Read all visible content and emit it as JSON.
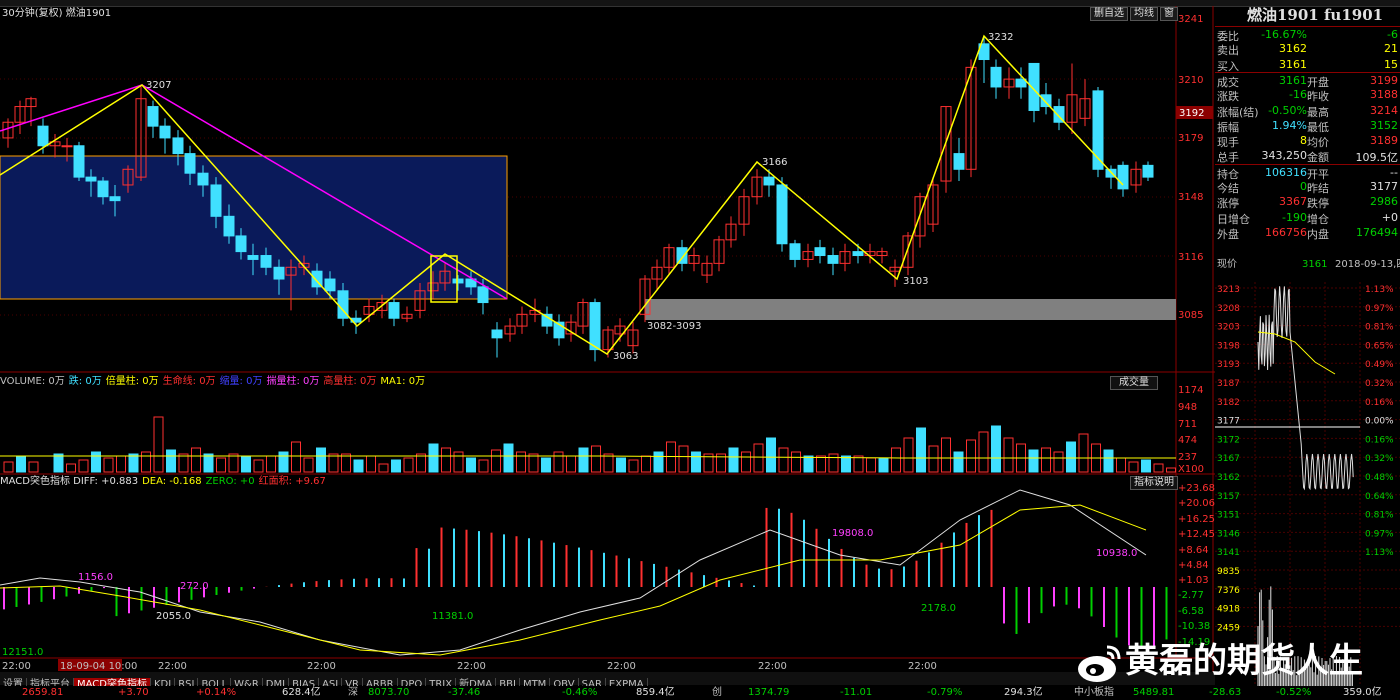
{
  "window": {
    "title": "30分钟(复权)  燃油1901"
  },
  "toolbar": {
    "buttons": [
      "删自选",
      "均线",
      "窗"
    ]
  },
  "price_axis": {
    "labels": [
      "3241",
      "3210",
      "3192",
      "3179",
      "3148",
      "3116",
      "3085"
    ],
    "current": "3192"
  },
  "annotations": {
    "p3207": "3207",
    "p3232": "3232",
    "p3166": "3166",
    "p3103": "3103",
    "p3063": "3063",
    "zone": "3082-3093"
  },
  "volume_bar": {
    "items": [
      {
        "text": "VOLUME: 0万",
        "color": "#c0c0c0"
      },
      {
        "text": "跌: 0万",
        "color": "#40e0ff"
      },
      {
        "text": "倍量柱: 0万",
        "color": "#ffff00"
      },
      {
        "text": "生命线: 0万",
        "color": "#ff3030"
      },
      {
        "text": "缩量: 0万",
        "color": "#4040ff"
      },
      {
        "text": "揣量柱: 0万",
        "color": "#ff40ff"
      },
      {
        "text": "高量柱: 0万",
        "color": "#ff3030"
      },
      {
        "text": "MA1: 0万",
        "color": "#ffff00"
      }
    ],
    "button": "成交量",
    "axis": [
      "1174",
      "948",
      "711",
      "474",
      "237",
      "X100"
    ]
  },
  "macd_bar": {
    "items": [
      {
        "text": "MACD突色指标 DIFF: +0.883",
        "color": "#e0e0e0"
      },
      {
        "text": "DEA: -0.168",
        "color": "#ffff00"
      },
      {
        "text": "ZERO: +0",
        "color": "#00d000"
      },
      {
        "text": "红面积: +9.67",
        "color": "#ff3030"
      }
    ],
    "button": "指标说明",
    "axis": [
      "+23.68",
      "+20.06",
      "+16.25",
      "+12.45",
      "+8.64",
      "+4.84",
      "+1.03",
      "-2.77",
      "-6.58",
      "-10.38",
      "-14.19"
    ],
    "labels": {
      "a": "1156.0",
      "b": "2055.0",
      "c": "11381.0",
      "d": "19808.0",
      "e": "10938.0",
      "f": "2178.0",
      "g": "12151.0",
      "h": "272.0"
    }
  },
  "time_axis": [
    "22:00",
    "18-09-04 10:00",
    "22:00",
    "22:00",
    "22:00",
    "22:00",
    "22:00",
    "22:00"
  ],
  "bottom_tabs": [
    "设置",
    "指标平台",
    "MACD突色指标",
    "KDJ",
    "RSI",
    "BOLL",
    "W&R",
    "DMI",
    "BIAS",
    "ASI",
    "VR",
    "ARBR",
    "DPO",
    "TRIX",
    "新DMA",
    "BBI",
    "MTM",
    "OBV",
    "SAR",
    "EXPMA"
  ],
  "status": [
    {
      "t": "2659.81",
      "c": "#ff3030"
    },
    {
      "t": "+3.70",
      "c": "#ff3030"
    },
    {
      "t": "+0.14%",
      "c": "#ff3030"
    },
    {
      "t": "628.4亿",
      "c": "#e0e0e0"
    },
    {
      "t": "深",
      "c": "#c0c0c0"
    },
    {
      "t": "8073.70",
      "c": "#00d000"
    },
    {
      "t": "-37.46",
      "c": "#00d000"
    },
    {
      "t": "-0.46%",
      "c": "#00d000"
    },
    {
      "t": "859.4亿",
      "c": "#e0e0e0"
    },
    {
      "t": "创",
      "c": "#c0c0c0"
    },
    {
      "t": "1374.79",
      "c": "#00d000"
    },
    {
      "t": "-11.01",
      "c": "#00d000"
    },
    {
      "t": "-0.79%",
      "c": "#00d000"
    },
    {
      "t": "294.3亿",
      "c": "#e0e0e0"
    },
    {
      "t": "中小板指",
      "c": "#c0c0c0"
    },
    {
      "t": "5489.81",
      "c": "#00d000"
    },
    {
      "t": "-28.63",
      "c": "#00d000"
    },
    {
      "t": "-0.52%",
      "c": "#00d000"
    },
    {
      "t": "359.0亿",
      "c": "#e0e0e0"
    }
  ],
  "quote": {
    "title": "燃油1901 fu1901",
    "rows": [
      {
        "l1": "委比",
        "v1": "-16.67%",
        "c1": "#00d000",
        "l2": "",
        "v2": "-6",
        "c2": "#00d000"
      },
      {
        "l1": "卖出",
        "v1": "3162",
        "c1": "#ffff00",
        "l2": "",
        "v2": "21",
        "c2": "#ffff00"
      },
      {
        "l1": "买入",
        "v1": "3161",
        "c1": "#ffff00",
        "l2": "",
        "v2": "15",
        "c2": "#ffff00"
      },
      {
        "l1": "成交",
        "v1": "3161",
        "c1": "#00d000",
        "l2": "开盘",
        "v2": "3199",
        "c2": "#ff3030"
      },
      {
        "l1": "涨跌",
        "v1": "-16",
        "c1": "#00d000",
        "l2": "昨收",
        "v2": "3188",
        "c2": "#ff3030"
      },
      {
        "l1": "涨幅(结)",
        "v1": "-0.50%",
        "c1": "#00d000",
        "l2": "最高",
        "v2": "3214",
        "c2": "#ff3030"
      },
      {
        "l1": "振幅",
        "v1": "1.94%",
        "c1": "#40e0ff",
        "l2": "最低",
        "v2": "3152",
        "c2": "#00d000"
      },
      {
        "l1": "现手",
        "v1": "8",
        "c1": "#ffff00",
        "l2": "均价",
        "v2": "3189",
        "c2": "#ff3030"
      },
      {
        "l1": "总手",
        "v1": "343,250",
        "c1": "#e0e0e0",
        "l2": "金额",
        "v2": "109.5亿",
        "c2": "#e0e0e0"
      },
      {
        "l1": "持仓",
        "v1": "106316",
        "c1": "#40e0ff",
        "l2": "开平",
        "v2": "--",
        "c2": "#e0e0e0"
      },
      {
        "l1": "今结",
        "v1": "0",
        "c1": "#00d000",
        "l2": "昨结",
        "v2": "3177",
        "c2": "#e0e0e0"
      },
      {
        "l1": "涨停",
        "v1": "3367",
        "c1": "#ff3030",
        "l2": "跌停",
        "v2": "2986",
        "c2": "#00d000"
      },
      {
        "l1": "日增仓",
        "v1": "-190",
        "c1": "#00d000",
        "l2": "增仓",
        "v2": "+0",
        "c2": "#e0e0e0"
      },
      {
        "l1": "外盘",
        "v1": "166756",
        "c1": "#ff3030",
        "l2": "内盘",
        "v2": "176494",
        "c2": "#00d000"
      }
    ],
    "now_label": "现价",
    "now_value": "3161",
    "date": "2018-09-13,四",
    "mini_left": [
      "3213",
      "3208",
      "3203",
      "3198",
      "3193",
      "3187",
      "3182",
      "3177",
      "3172",
      "3167",
      "3162",
      "3157",
      "3151",
      "3146",
      "3141",
      "9835",
      "7376",
      "4918",
      "2459"
    ],
    "mini_right": [
      "1.13%",
      "0.97%",
      "0.81%",
      "0.65%",
      "0.49%",
      "0.32%",
      "0.16%",
      "0.00%",
      "0.16%",
      "0.32%",
      "0.48%",
      "0.64%",
      "0.81%",
      "0.97%",
      "1.13%"
    ]
  },
  "watermark": "黄磊的期货人生",
  "colors": {
    "up": "#ff3030",
    "down": "#40e0ff",
    "box_fill": "#0a1a5a",
    "box_border": "#ffa000",
    "zone": "#808080",
    "zig": "#ffff00",
    "trend": "#ff00ff"
  }
}
